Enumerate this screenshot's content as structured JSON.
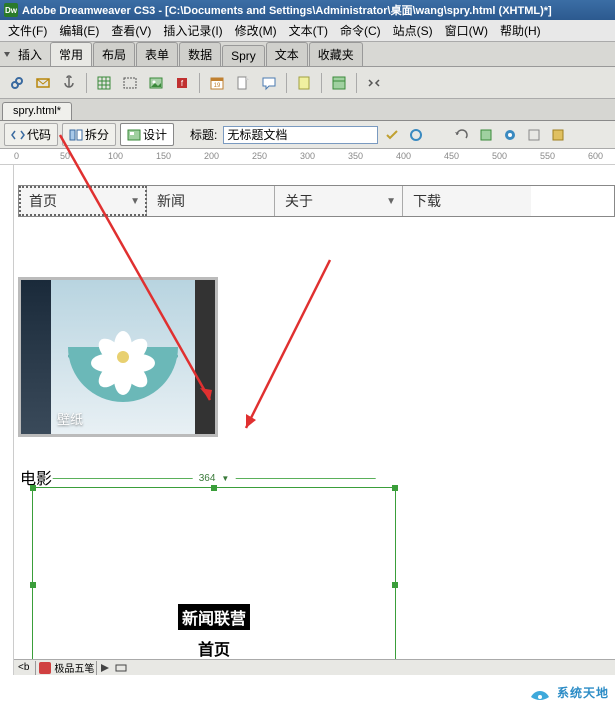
{
  "app": {
    "title": "Adobe Dreamweaver CS3 - [C:\\Documents and Settings\\Administrator\\桌面\\wang\\spry.html (XHTML)*]"
  },
  "menu": {
    "file": "文件(F)",
    "edit": "编辑(E)",
    "view": "查看(V)",
    "insert": "插入记录(I)",
    "modify": "修改(M)",
    "text": "文本(T)",
    "commands": "命令(C)",
    "site": "站点(S)",
    "window": "窗口(W)",
    "help": "帮助(H)"
  },
  "insertbar": {
    "label": "插入",
    "tabs": {
      "common": "常用",
      "layout": "布局",
      "form": "表单",
      "data": "数据",
      "spry": "Spry",
      "text": "文本",
      "favorite": "收藏夹"
    }
  },
  "doc_tab": "spry.html*",
  "mode": {
    "code": "代码",
    "split": "拆分",
    "design": "设计",
    "title_label": "标题:",
    "title_value": "无标题文档"
  },
  "ruler": [
    "0",
    "50",
    "100",
    "150",
    "200",
    "250",
    "300",
    "350",
    "400",
    "450",
    "500",
    "550",
    "600"
  ],
  "spry_menu": {
    "home": "首页",
    "news": "新闻",
    "about": "关于",
    "download": "下载"
  },
  "thumb_caption": "壁纸",
  "movie_label": "电影",
  "selection": {
    "width_label": "364",
    "heading": "新闻联营",
    "page": "首页"
  },
  "statusbar": {
    "ime": "极品五笔"
  },
  "watermark": "系统天地",
  "colors": {
    "brand_blue": "#2c5a8f",
    "selection_green": "#3a9e3a",
    "arrow_red": "#e03030"
  }
}
